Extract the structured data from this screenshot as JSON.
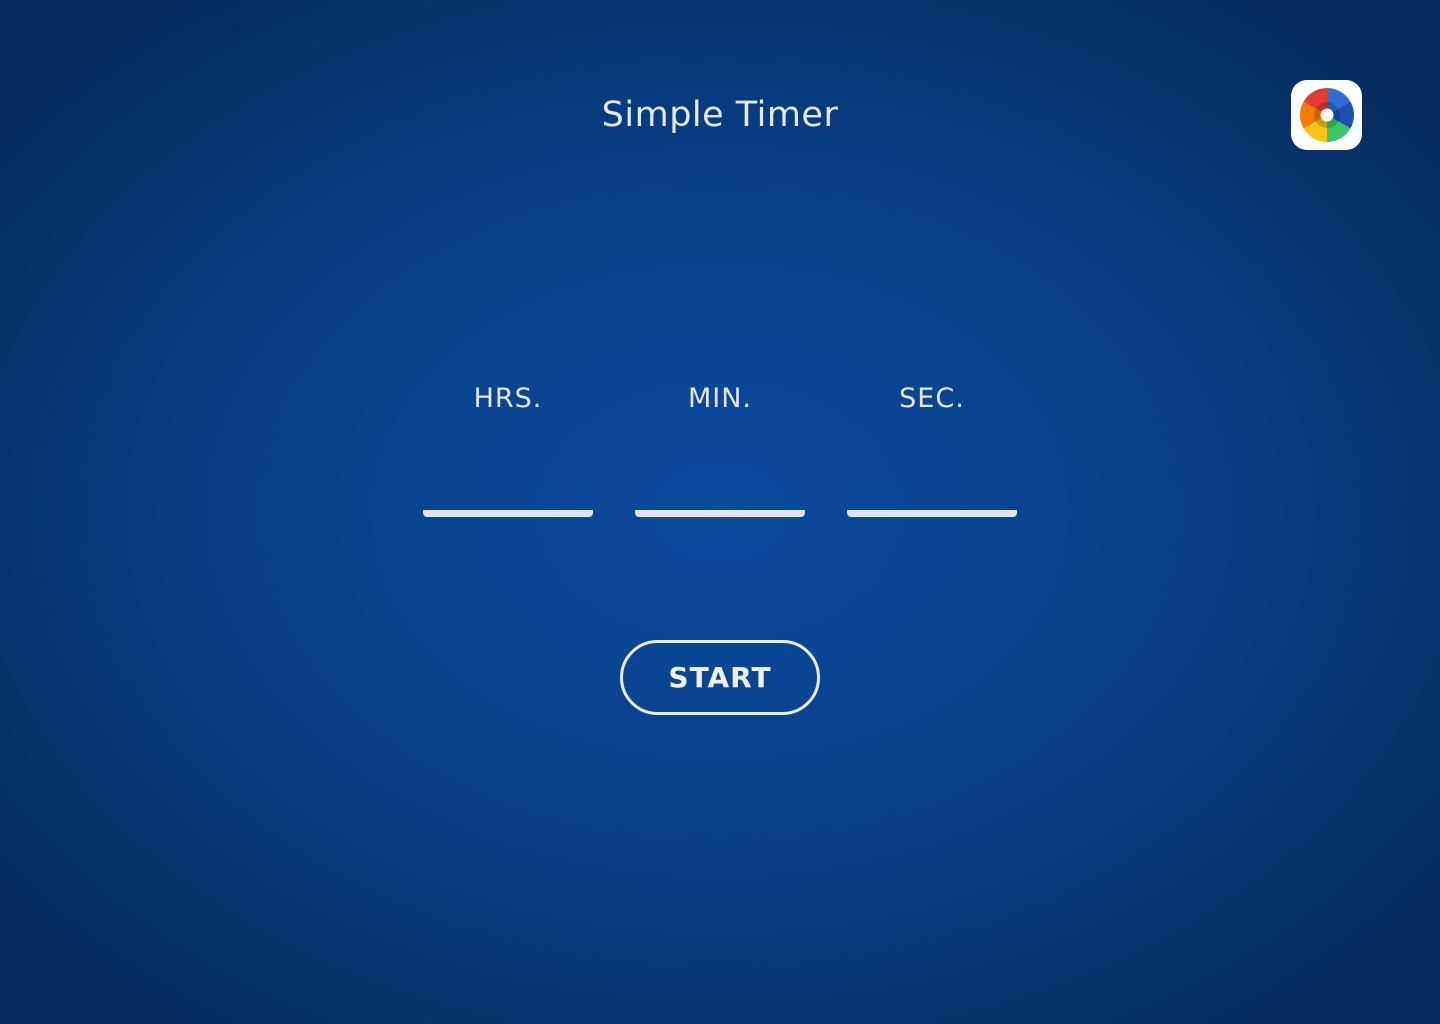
{
  "app": {
    "title": "Simple Timer"
  },
  "theme_button": {
    "icon": "color-wheel-icon",
    "colors": [
      "#2e6fd3",
      "#1c4fb0",
      "#3ec56a",
      "#f5c518",
      "#f57c00",
      "#e53935"
    ]
  },
  "timer": {
    "fields": [
      {
        "label": "HRS.",
        "value": "",
        "placeholder": ""
      },
      {
        "label": "MIN.",
        "value": "",
        "placeholder": ""
      },
      {
        "label": "SEC.",
        "value": "",
        "placeholder": ""
      }
    ]
  },
  "actions": {
    "start_label": "START"
  },
  "colors": {
    "background_center": "#0b4a9c",
    "background_edge": "#062c60",
    "text": "#e3e8f2",
    "underline": "#dfe4ee"
  }
}
